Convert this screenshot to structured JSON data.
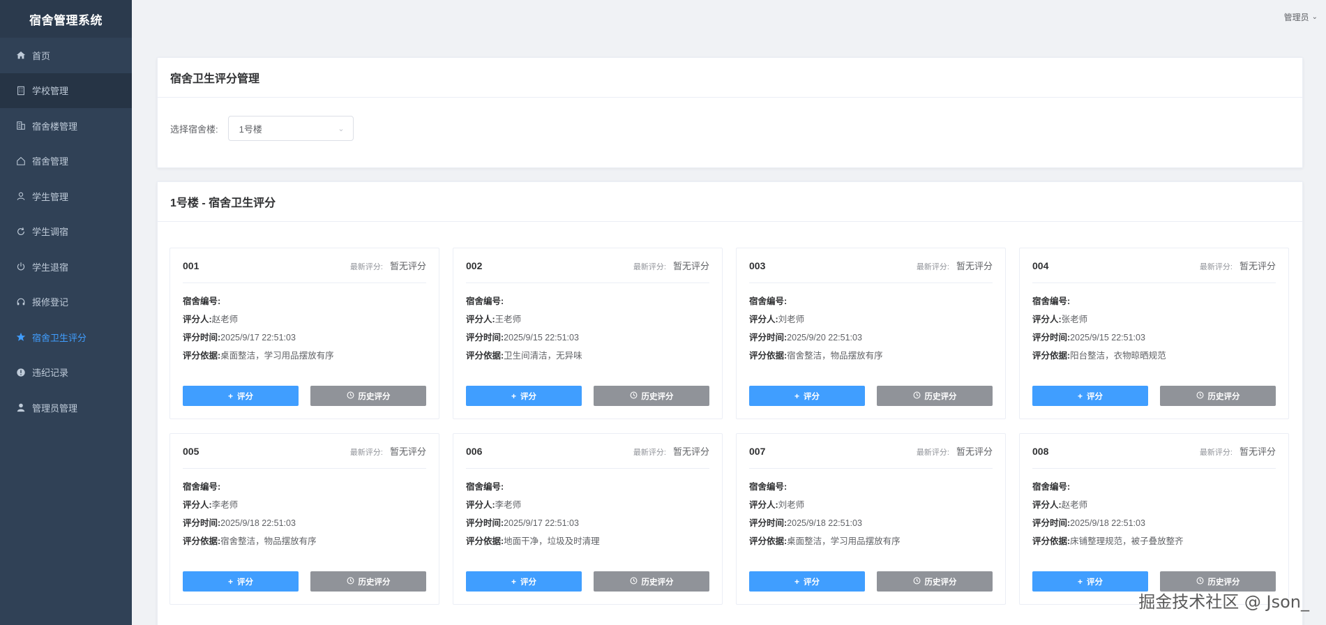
{
  "app_title": "宿舍管理系统",
  "user_menu": "管理员",
  "sidebar": {
    "items": [
      {
        "label": "首页",
        "icon": "home-icon"
      },
      {
        "label": "学校管理",
        "icon": "building-icon"
      },
      {
        "label": "宿舍楼管理",
        "icon": "office-building-icon"
      },
      {
        "label": "宿舍管理",
        "icon": "house-icon"
      },
      {
        "label": "学生管理",
        "icon": "user-icon"
      },
      {
        "label": "学生调宿",
        "icon": "refresh-icon"
      },
      {
        "label": "学生退宿",
        "icon": "power-icon"
      },
      {
        "label": "报修登记",
        "icon": "headset-icon"
      },
      {
        "label": "宿舍卫生评分",
        "icon": "star-icon"
      },
      {
        "label": "违纪记录",
        "icon": "warning-icon"
      },
      {
        "label": "管理员管理",
        "icon": "person-icon"
      }
    ]
  },
  "filter_panel": {
    "title": "宿舍卫生评分管理",
    "select_label": "选择宿舍楼:",
    "select_value": "1号楼"
  },
  "cards_panel": {
    "title": "1号楼 - 宿舍卫生评分",
    "latest_label": "最新评分:",
    "labels": {
      "room_code": "宿舍编号:",
      "rater": "评分人:",
      "time": "评分时间:",
      "basis": "评分依据:"
    },
    "rate_button": "评分",
    "history_button": "历史评分",
    "cards": [
      {
        "room": "001",
        "latest": "暂无评分",
        "code": "",
        "rater": "赵老师",
        "time": "2025/9/17 22:51:03",
        "basis": "桌面整洁，学习用品摆放有序"
      },
      {
        "room": "002",
        "latest": "暂无评分",
        "code": "",
        "rater": "王老师",
        "time": "2025/9/15 22:51:03",
        "basis": "卫生间清洁，无异味"
      },
      {
        "room": "003",
        "latest": "暂无评分",
        "code": "",
        "rater": "刘老师",
        "time": "2025/9/20 22:51:03",
        "basis": "宿舍整洁，物品摆放有序"
      },
      {
        "room": "004",
        "latest": "暂无评分",
        "code": "",
        "rater": "张老师",
        "time": "2025/9/15 22:51:03",
        "basis": "阳台整洁，衣物晾晒规范"
      },
      {
        "room": "005",
        "latest": "暂无评分",
        "code": "",
        "rater": "李老师",
        "time": "2025/9/18 22:51:03",
        "basis": "宿舍整洁，物品摆放有序"
      },
      {
        "room": "006",
        "latest": "暂无评分",
        "code": "",
        "rater": "李老师",
        "time": "2025/9/17 22:51:03",
        "basis": "地面干净，垃圾及时清理"
      },
      {
        "room": "007",
        "latest": "暂无评分",
        "code": "",
        "rater": "刘老师",
        "time": "2025/9/18 22:51:03",
        "basis": "桌面整洁，学习用品摆放有序"
      },
      {
        "room": "008",
        "latest": "暂无评分",
        "code": "",
        "rater": "赵老师",
        "time": "2025/9/18 22:51:03",
        "basis": "床铺整理规范，被子叠放整齐"
      }
    ]
  },
  "watermark": "掘金技术社区 @ Json_",
  "colors": {
    "sidebar_bg": "#304156",
    "active": "#409eff",
    "rate_button": "#409eff",
    "history_button": "#909399"
  }
}
